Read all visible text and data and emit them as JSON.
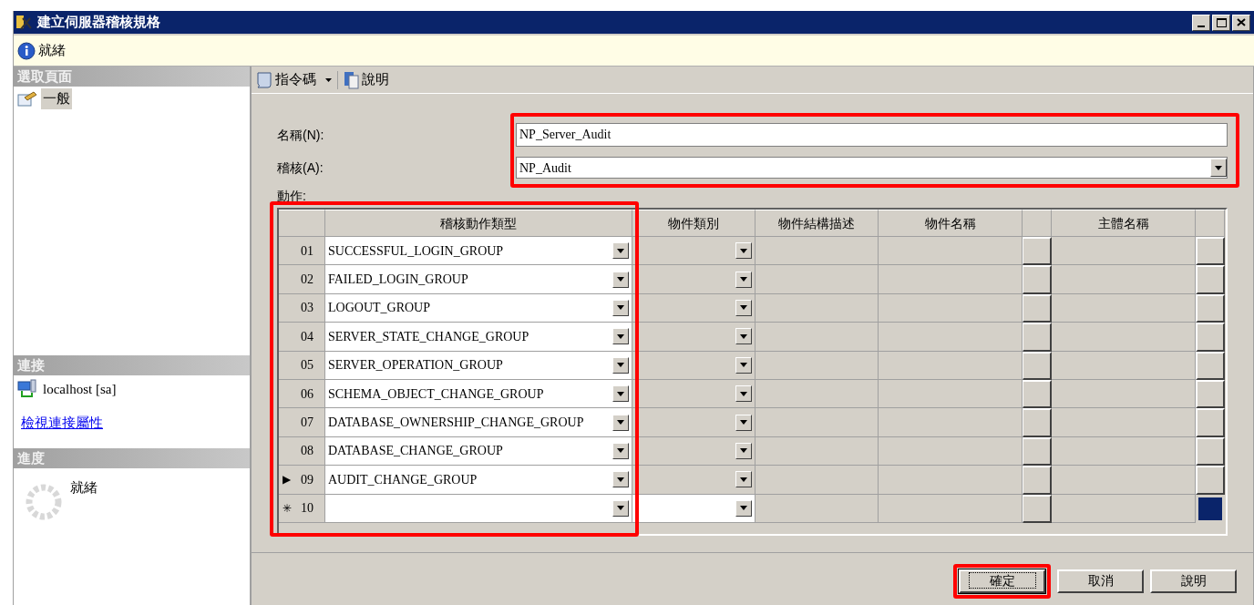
{
  "window": {
    "title": "建立伺服器稽核規格"
  },
  "info_bar": {
    "text": "就緒"
  },
  "sidebar": {
    "select_page": {
      "header": "選取頁面",
      "items": [
        {
          "label": "一般",
          "selected": true
        }
      ]
    },
    "connection": {
      "header": "連接",
      "server": "localhost [sa]",
      "link": "檢視連接屬性"
    },
    "progress": {
      "header": "進度",
      "status": "就緒"
    }
  },
  "toolbar": {
    "script": "指令碼",
    "help": "說明"
  },
  "form": {
    "name_label": "名稱(N):",
    "name_value": "NP_Server_Audit",
    "audit_label": "稽核(A):",
    "audit_value": "NP_Audit",
    "actions_label": "動作:"
  },
  "table": {
    "columns": [
      "稽核動作類型",
      "物件類別",
      "物件結構描述",
      "物件名稱",
      "主體名稱"
    ],
    "rows": [
      {
        "kind": "entry",
        "marker": "",
        "number": "01",
        "action_type": "SUCCESSFUL_LOGIN_GROUP",
        "selected": false
      },
      {
        "kind": "entry",
        "marker": "",
        "number": "02",
        "action_type": "FAILED_LOGIN_GROUP",
        "selected": false
      },
      {
        "kind": "entry",
        "marker": "",
        "number": "03",
        "action_type": "LOGOUT_GROUP",
        "selected": false
      },
      {
        "kind": "entry",
        "marker": "",
        "number": "04",
        "action_type": "SERVER_STATE_CHANGE_GROUP",
        "selected": false
      },
      {
        "kind": "entry",
        "marker": "",
        "number": "05",
        "action_type": "SERVER_OPERATION_GROUP",
        "selected": false
      },
      {
        "kind": "entry",
        "marker": "",
        "number": "06",
        "action_type": "SCHEMA_OBJECT_CHANGE_GROUP",
        "selected": false
      },
      {
        "kind": "entry",
        "marker": "",
        "number": "07",
        "action_type": "DATABASE_OWNERSHIP_CHANGE_GROUP",
        "selected": false
      },
      {
        "kind": "entry",
        "marker": "",
        "number": "08",
        "action_type": "DATABASE_CHANGE_GROUP",
        "selected": false
      },
      {
        "kind": "entry",
        "marker": "▶",
        "number": "09",
        "action_type": "AUDIT_CHANGE_GROUP",
        "selected": false
      },
      {
        "kind": "new",
        "marker": "✳",
        "number": "10",
        "action_type": "",
        "selected": true
      }
    ]
  },
  "buttons": [
    {
      "label": "確定",
      "focused": true
    },
    {
      "label": "取消",
      "focused": false
    },
    {
      "label": "說明",
      "focused": false
    }
  ]
}
